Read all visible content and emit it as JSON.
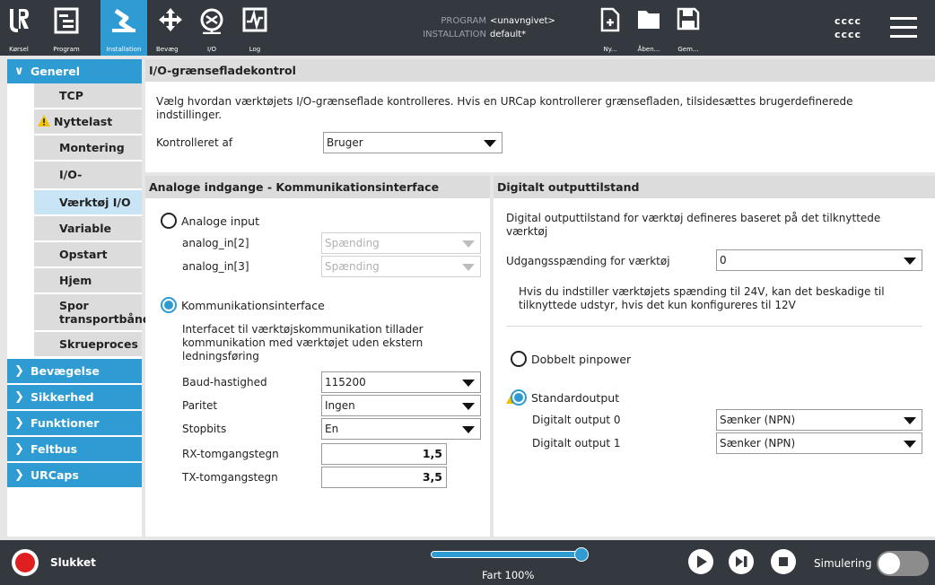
{
  "topbar": {
    "tabs": [
      {
        "label": "Kørsel",
        "icon": "ur-logo-icon"
      },
      {
        "label": "Program",
        "icon": "program-icon"
      },
      {
        "label": "Installation",
        "icon": "installation-icon",
        "active": true
      }
    ],
    "tools": [
      {
        "label": "Bevæg",
        "icon": "move-icon"
      },
      {
        "label": "I/O",
        "icon": "io-icon"
      },
      {
        "label": "Log",
        "icon": "log-icon"
      }
    ],
    "program_key": "PROGRAM",
    "program_value": "<unavngivet>",
    "installation_key": "INSTALLATION",
    "installation_value": "default*",
    "file_buttons": [
      {
        "label": "Ny...",
        "icon": "new-file-icon"
      },
      {
        "label": "Åben...",
        "icon": "folder-icon"
      },
      {
        "label": "Gem...",
        "icon": "save-icon"
      }
    ],
    "robot_id_1": "cccc",
    "robot_id_2": "cccc"
  },
  "nav": {
    "generel": "Generel",
    "sub_items": [
      "TCP",
      "Nyttelast",
      "Montering",
      "I/O-opsætning",
      "Værktøj I/O",
      "Variable",
      "Opstart",
      "Hjem",
      "Spor transportbånd",
      "Skrueproces"
    ],
    "selected": "Værktøj I/O",
    "sections": [
      "Bevægelse",
      "Sikkerhed",
      "Funktioner",
      "Feltbus",
      "URCaps"
    ]
  },
  "io_control": {
    "title": "I/O-grænsefladekontrol",
    "description": "Vælg hvordan værktøjets I/O-grænseflade kontrolleres. Hvis en URCap kontrollerer grænsefladen, tilsidesættes brugerdefinerede indstillinger.",
    "controlled_by_label": "Kontrolleret af",
    "controlled_by_value": "Bruger"
  },
  "analog": {
    "title": "Analoge indgange - Kommunikationsinterface",
    "analog_input_label": "Analoge input",
    "ain2_label": "analog_in[2]",
    "ain2_value": "Spænding",
    "ain3_label": "analog_in[3]",
    "ain3_value": "Spænding",
    "comm_label": "Kommunikationsinterface",
    "comm_description": "Interfacet til værktøjskommunikation tillader kommunikation med værktøjet uden ekstern ledningsføring",
    "baud_label": "Baud-hastighed",
    "baud_value": "115200",
    "parity_label": "Paritet",
    "parity_value": "Ingen",
    "stopbits_label": "Stopbits",
    "stopbits_value": "En",
    "rx_label": "RX-tomgangstegn",
    "rx_value": "1,5",
    "tx_label": "TX-tomgangstegn",
    "tx_value": "3,5"
  },
  "digital": {
    "title": "Digitalt outputtilstand",
    "description": "Digital outputtilstand for værktøj defineres baseret på det tilknyttede værktøj",
    "voltage_label": "Udgangsspænding for værktøj",
    "voltage_value": "0",
    "warning": "Hvis du indstiller værktøjets spænding til 24V, kan det beskadige til tilknyttede udstyr, hvis det kun konfigureres til 12V",
    "dual_pin_label": "Dobbelt pinpower",
    "standard_label": "Standardoutput",
    "do0_label": "Digitalt output 0",
    "do0_value": "Sænker (NPN)",
    "do1_label": "Digitalt output 1",
    "do1_value": "Sænker (NPN)"
  },
  "bottombar": {
    "power_label": "Slukket",
    "speed_label": "Fart 100%",
    "speed_fraction": 1.0,
    "sim_label": "Simulering"
  },
  "colors": {
    "accent": "#2f9bd3",
    "bar": "#33393f",
    "header": "#dcdcdc",
    "power_off": "#e02020"
  }
}
